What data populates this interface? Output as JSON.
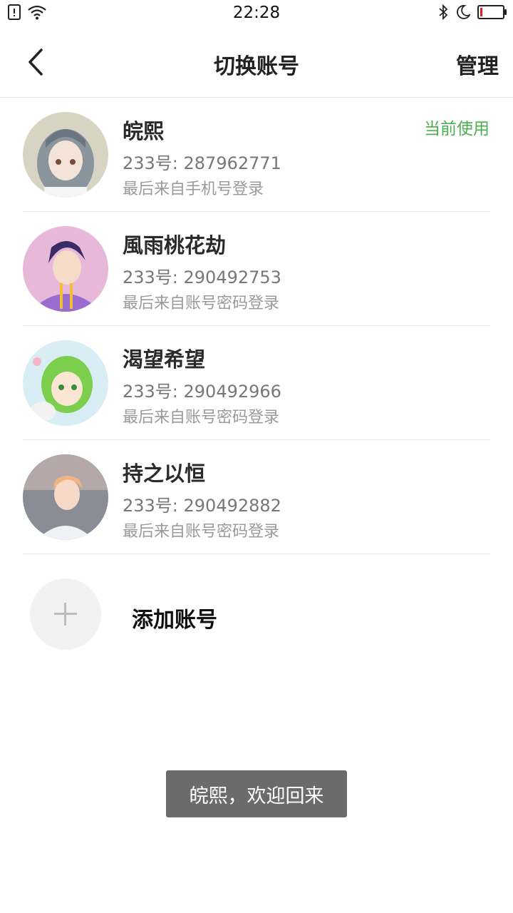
{
  "status_bar": {
    "time": "22:28",
    "icons_left": [
      "sim-alert-icon",
      "wifi-icon"
    ],
    "icons_right": [
      "bluetooth-icon",
      "moon-icon",
      "battery-icon"
    ],
    "battery_level": 0.1,
    "battery_color": "#e0201e"
  },
  "nav": {
    "back_icon": "chevron-left-icon",
    "title": "切换账号",
    "manage_label": "管理"
  },
  "accounts": [
    {
      "name": "皖熙",
      "uid": "233号: 287962771",
      "login": "最后来自手机号登录",
      "current_label": "当前使用"
    },
    {
      "name": "風雨桃花劫",
      "uid": "233号: 290492753",
      "login": "最后来自账号密码登录"
    },
    {
      "name": "渴望希望",
      "uid": "233号: 290492966",
      "login": "最后来自账号密码登录"
    },
    {
      "name": "持之以恒",
      "uid": "233号: 290492882",
      "login": "最后来自账号密码登录"
    }
  ],
  "add_account": {
    "label": "添加账号",
    "icon": "plus-icon"
  },
  "toast": "皖熙，欢迎回来",
  "colors": {
    "accent": "#4caf50",
    "toast_bg": "#6b6b6b"
  }
}
